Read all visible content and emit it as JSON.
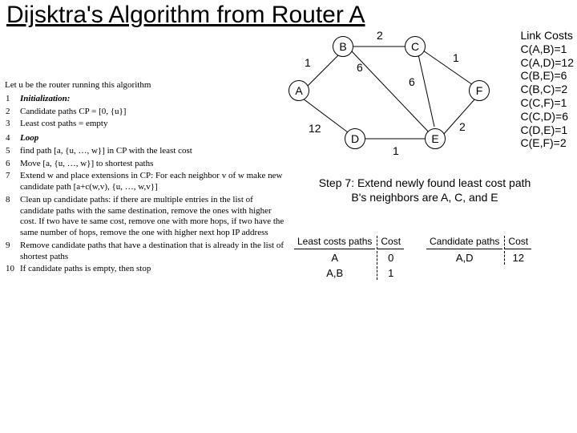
{
  "title": "Dijsktra's Algorithm from Router A",
  "algo": {
    "intro": "Let u be the router running this algorithm",
    "lines": [
      {
        "n": "1",
        "t": "Initialization:",
        "ital": true
      },
      {
        "n": "2",
        "t": "Candidate paths CP = [0, {u}]"
      },
      {
        "n": "3",
        "t": "Least cost paths = empty"
      },
      {
        "n": "",
        "t": ""
      },
      {
        "n": "4",
        "t": "Loop",
        "ital": true
      },
      {
        "n": "5",
        "t": "find path [a, {u, …, w}] in CP with the least cost"
      },
      {
        "n": "6",
        "t": "Move [a, {u, …, w}] to shortest paths"
      },
      {
        "n": "7",
        "t": "Extend w and place extensions in CP: For each neighbor v of w make new candidate path [a+c(w,v), {u, …, w,v}]"
      },
      {
        "n": "8",
        "t": "Clean up candidate paths: if there are multiple entries in the list of candidate paths with the same destination, remove the ones with higher cost. If two have te same cost, remove one with more hops, if two have the same number of hops, remove the one with higher next hop IP address"
      },
      {
        "n": "9",
        "t": "Remove candidate paths that have a destination that is already in the list of shortest paths"
      },
      {
        "n": "10",
        "t": "If candidate paths is empty, then stop"
      }
    ]
  },
  "graph": {
    "nodes": {
      "A": "A",
      "B": "B",
      "C": "C",
      "D": "D",
      "E": "E",
      "F": "F"
    },
    "edge_labels": {
      "AB": "1",
      "BC": "2",
      "CF": "1",
      "BE": "6",
      "CE": "6",
      "AD": "12",
      "DE": "1",
      "EF": "2"
    }
  },
  "link_costs": {
    "title": "Link Costs",
    "rows": [
      "C(A,B)=1",
      "C(A,D)=12",
      "C(B,E)=6",
      "C(B,C)=2",
      "C(C,F)=1",
      "C(C,D)=6",
      "C(D,E)=1",
      "C(E,F)=2"
    ]
  },
  "step": {
    "line1": "Step 7: Extend newly found least cost path",
    "line2": "B's neighbors are A, C, and E"
  },
  "tables": {
    "least": {
      "h1": "Least costs paths",
      "h2": "Cost",
      "rows": [
        [
          "A",
          "0"
        ],
        [
          "A,B",
          "1"
        ]
      ]
    },
    "cand": {
      "h1": "Candidate paths",
      "h2": "Cost",
      "rows": [
        [
          "A,D",
          "12"
        ]
      ]
    }
  }
}
